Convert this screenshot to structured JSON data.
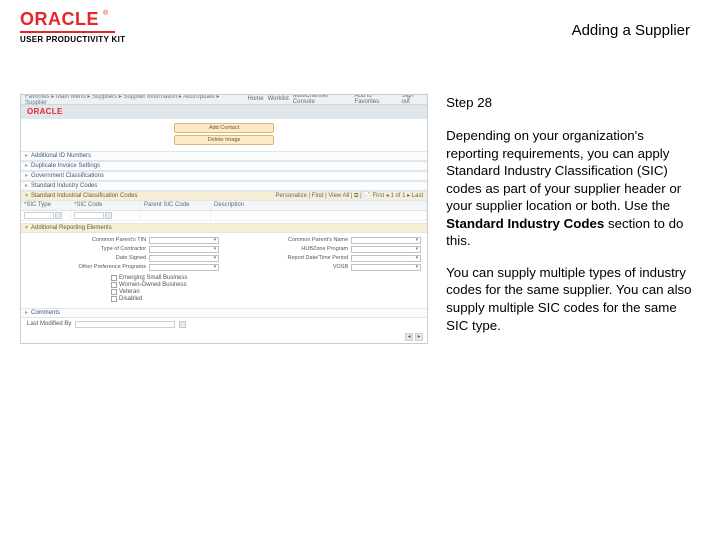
{
  "header": {
    "logo_text": "ORACLE",
    "tm": "®",
    "product": "USER PRODUCTIVITY KIT",
    "title": "Adding a Supplier"
  },
  "screenshot": {
    "breadcrumb": "Favorites ▸  Main Menu ▸  Suppliers ▸  Supplier Information ▸  Add/Update ▸  Supplier",
    "nav": [
      "Home",
      "Worklist",
      "MultiChannel Console",
      "Add to Favorites",
      "Sign out"
    ],
    "brand": "ORACLE",
    "buttons": [
      "Add Contact",
      "Delete Image"
    ],
    "sections": [
      "Additional ID Numbers",
      "Duplicate Invoice Settings",
      "Government Classifications",
      "Standard Industry Codes",
      "Standard Industrial Classification Codes",
      "Additional Reporting Elements",
      "Comments"
    ],
    "grid_tools": "Personalize | Find | View All | ⧉ | 📄   First ◂ 1 of 1 ▸ Last",
    "grid": {
      "cols": [
        "*SIC Type",
        "*SIC Code",
        "Parent SIC Code",
        "Description"
      ]
    },
    "form": {
      "left": [
        "Common Parent's TIN",
        "Type of Contractor",
        "Date Signed",
        "Other Preference Programs"
      ],
      "right": [
        "Common Parent's Name",
        "HUBZone Program",
        "Report Date/Time Period",
        "VOSB"
      ]
    },
    "checks": [
      "Emerging Small Business",
      "Women-Owned Business",
      "Veteran",
      "Disabled"
    ],
    "bottom": {
      "label": "Last Modified By"
    }
  },
  "instructions": {
    "step": "Step 28",
    "p1a": "Depending on your organization's reporting requirements, you can apply Standard Industry Classification (SIC) codes as part of your supplier header or your supplier location or both. Use the ",
    "p1bold": "Standard Industry Codes",
    "p1b": " section to do this.",
    "p2": "You can supply multiple types of industry codes for the same supplier. You can also supply multiple SIC codes for the same SIC type."
  }
}
